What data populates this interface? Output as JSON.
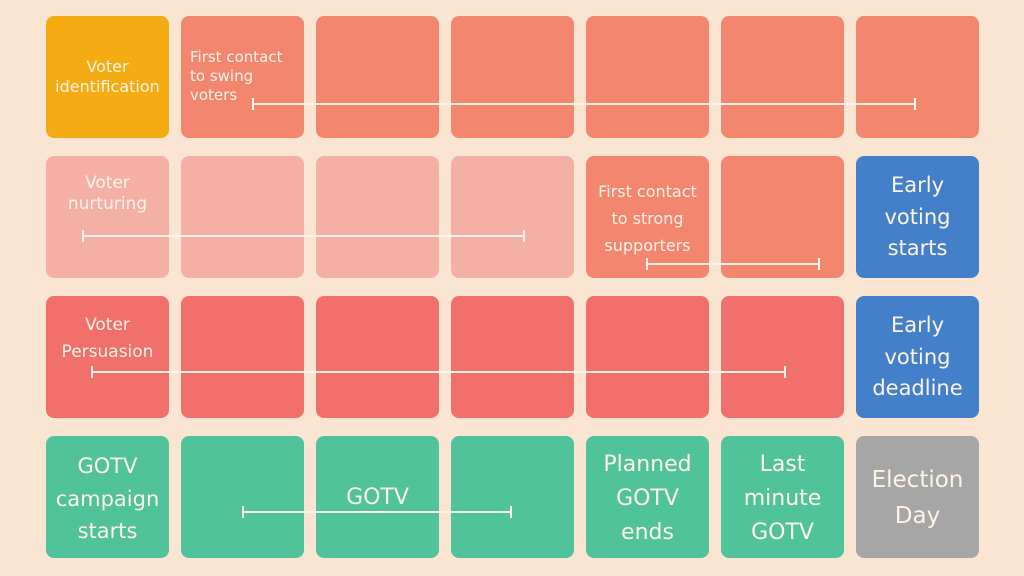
{
  "colors": {
    "background": "#fae5d3",
    "identification": "#f5ab12",
    "swing": "#f3866f",
    "nurturing": "#f5b0a6",
    "persuasion": "#f1706b",
    "gotv": "#51c39b",
    "early_voting": "#4480c9",
    "election_day": "#a6a6a6"
  },
  "rows": [
    {
      "cells": [
        "identification",
        "swing",
        "swing",
        "swing",
        "swing",
        "swing",
        "swing"
      ]
    },
    {
      "cells": [
        "nurturing",
        "nurturing",
        "nurturing",
        "nurturing",
        "swing",
        "swing",
        "early_voting"
      ]
    },
    {
      "cells": [
        "persuasion",
        "persuasion",
        "persuasion",
        "persuasion",
        "persuasion",
        "persuasion",
        "early_voting"
      ]
    },
    {
      "cells": [
        "gotv",
        "gotv",
        "gotv",
        "gotv",
        "gotv",
        "gotv",
        "election_day"
      ]
    }
  ],
  "labels": {
    "voter_identification": "Voter\nidentification",
    "first_contact_swing": "First contact\nto swing\nvoters",
    "voter_nurturing": "Voter\nnurturing",
    "first_contact_strong": "First contact\nto strong\nsupporters",
    "early_voting_starts": "Early\nvoting\nstarts",
    "voter_persuasion": "Voter\nPersuasion",
    "early_voting_deadline": "Early\nvoting\ndeadline",
    "gotv_campaign_starts": "GOTV\ncampaign\nstarts",
    "gotv": "GOTV",
    "planned_gotv_ends": "Planned\nGOTV\nends",
    "last_minute_gotv": "Last\nminute\nGOTV",
    "election_day": "Election\nDay"
  }
}
